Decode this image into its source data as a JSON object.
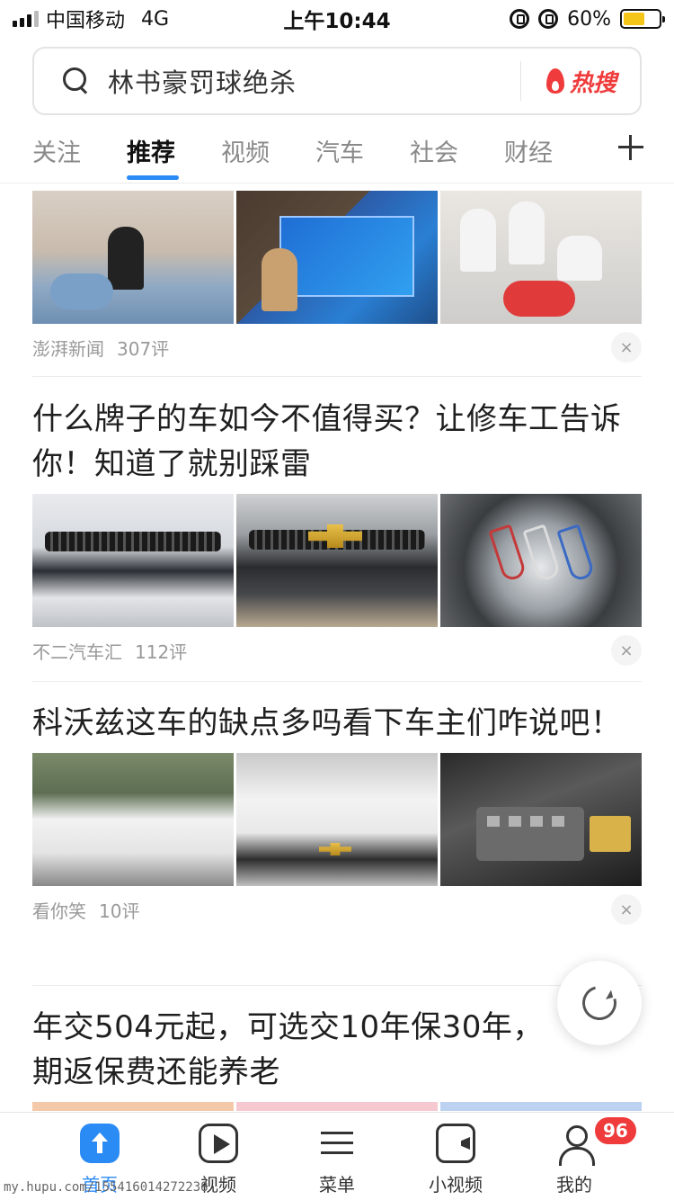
{
  "status_bar": {
    "carrier": "中国移动",
    "network": "4G",
    "time": "上午10:44",
    "battery_percent": "60%",
    "battery_level": 0.6,
    "icons": [
      "signal-icon",
      "rotation-lock-icon",
      "alarm-icon",
      "battery-icon"
    ]
  },
  "search": {
    "query": "林书豪罚球绝杀",
    "hot_label": "热搜"
  },
  "tabs": [
    {
      "label": "关注",
      "active": false
    },
    {
      "label": "推荐",
      "active": true
    },
    {
      "label": "视频",
      "active": false
    },
    {
      "label": "汽车",
      "active": false
    },
    {
      "label": "社会",
      "active": false
    },
    {
      "label": "财经",
      "active": false
    }
  ],
  "feed": {
    "items": [
      {
        "title": "",
        "source": "澎湃新闻",
        "comments": "307评"
      },
      {
        "title": "什么牌子的车如今不值得买？让修车工告诉你！知道了就别踩雷",
        "source": "不二汽车汇",
        "comments": "112评"
      },
      {
        "title": "科沃兹这车的缺点多吗看下车主们咋说吧！",
        "source": "看你笑",
        "comments": "10评"
      },
      {
        "title": "年交504元起，可选交10年保30年，期返保费还能养老",
        "source": "",
        "comments": ""
      }
    ],
    "close_glyph": "×"
  },
  "bottom_nav": {
    "items": [
      {
        "label": "首页",
        "icon": "home-icon",
        "active": true
      },
      {
        "label": "视频",
        "icon": "play-icon",
        "active": false
      },
      {
        "label": "菜单",
        "icon": "menu-icon",
        "active": false
      },
      {
        "label": "小视频",
        "icon": "video-camera-icon",
        "active": false
      },
      {
        "label": "我的",
        "icon": "profile-icon",
        "active": false
      }
    ],
    "badge_count": "96"
  },
  "watermark": "my.hupu.com/155416014272238",
  "colors": {
    "accent": "#2b8bf5",
    "hot": "#ef3b3b",
    "battery": "#f5c518"
  }
}
